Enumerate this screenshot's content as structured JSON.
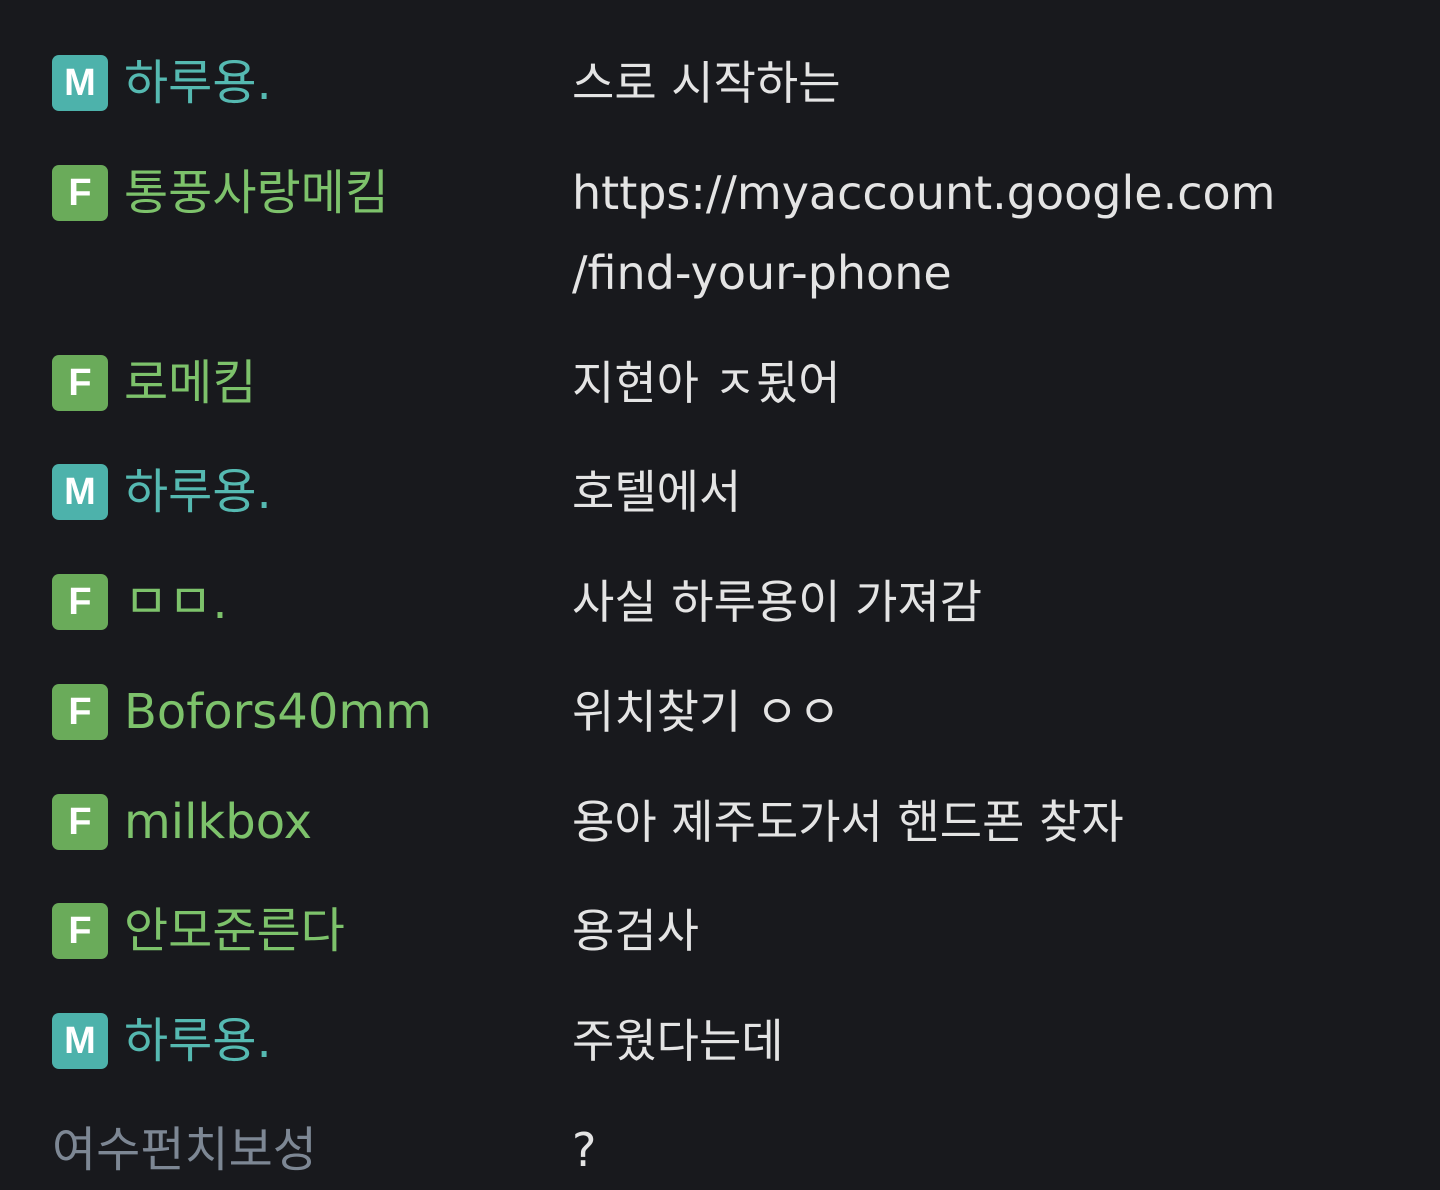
{
  "messages": [
    {
      "badge": "M",
      "nick": "하루용.",
      "text": "스로 시작하는"
    },
    {
      "badge": "F",
      "nick": "통풍사랑메킴",
      "text": "https://myaccount.google.com\n/find-your-phone"
    },
    {
      "badge": "F",
      "nick": "로메킴",
      "text": "지현아 ㅈ됬어"
    },
    {
      "badge": "M",
      "nick": "하루용.",
      "text": "호텔에서"
    },
    {
      "badge": "F",
      "nick": "ㅁㅁ.",
      "text": "사실 하루용이 가져감"
    },
    {
      "badge": "F",
      "nick": "Bofors40mm",
      "text": "위치찾기 ㅇㅇ"
    },
    {
      "badge": "F",
      "nick": "milkbox",
      "text": "용아 제주도가서 핸드폰 찾자"
    },
    {
      "badge": "F",
      "nick": "안모준른다",
      "text": "용검사"
    },
    {
      "badge": "M",
      "nick": "하루용.",
      "text": "주웠다는데"
    },
    {
      "badge": "",
      "nick": "여수펀치보성",
      "text": "?"
    }
  ]
}
